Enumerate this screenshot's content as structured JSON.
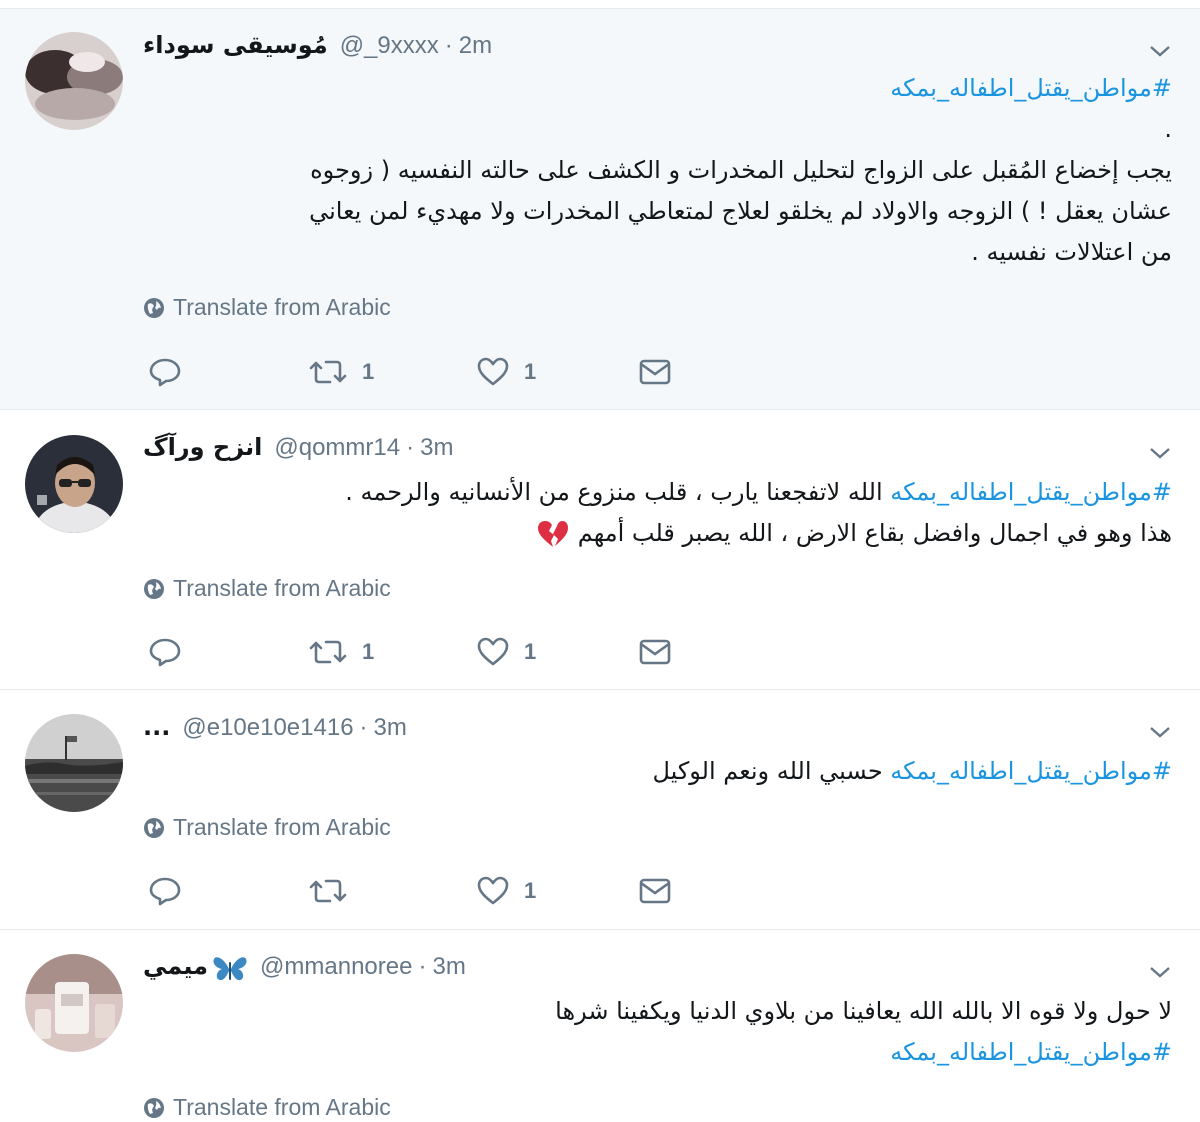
{
  "colors": {
    "hashtag": "#1b95e0",
    "muted": "#657786",
    "text": "#14171a",
    "highlight_bg": "#f5f8fa"
  },
  "tweets": [
    {
      "name": "مُوسيقى سوداء",
      "handle": "@_9xxxx",
      "sep": "·",
      "time": "2m",
      "lines": [
        {
          "tag": "#مواطن_يقتل_اطفاله_بمكه",
          "text": ""
        },
        {
          "tag": "",
          "text": "."
        },
        {
          "tag": "",
          "text": "يجب إخضاع المُقبل على الزواج لتحليل المخدرات و الكشف على حالته النفسيه ( زوجوه"
        },
        {
          "tag": "",
          "text": "عشان يعقل ! ) الزوجه والاولاد لم يخلقو لعلاج لمتعاطي المخدرات ولا مهديء لمن يعاني"
        },
        {
          "tag": "",
          "text": "من اعتلالات نفسيه ."
        }
      ],
      "translate": "Translate from Arabic",
      "retweets": "1",
      "likes": "1",
      "avatar_icon": "avatar-photo"
    },
    {
      "name": "انزح ورآگ",
      "handle": "@qommr14",
      "sep": "·",
      "time": "3m",
      "lines": [
        {
          "tag": "#مواطن_يقتل_اطفاله_بمكه",
          "text": " الله لاتفجعنا يارب ، قلب منزوع من الأنسانيه والرحمه ."
        },
        {
          "tag": "",
          "text": "هذا وهو في اجمال وافضل بقاع الارض ، الله يصبر قلب أمهم"
        }
      ],
      "emoji": "broken-heart-icon",
      "translate": "Translate from Arabic",
      "retweets": "1",
      "likes": "1",
      "avatar_icon": "avatar-photo"
    },
    {
      "name": "...",
      "handle": "@e10e10e1416",
      "sep": "·",
      "time": "3m",
      "lines": [
        {
          "tag": "#مواطن_يقتل_اطفاله_بمكه",
          "text": " حسبي الله ونعم الوكيل"
        }
      ],
      "translate": "Translate from Arabic",
      "retweets": "",
      "likes": "1",
      "avatar_icon": "avatar-photo"
    },
    {
      "name": "ميمي",
      "name_emoji": "butterfly-icon",
      "handle": "@mmannoree",
      "sep": "·",
      "time": "3m",
      "lines": [
        {
          "tag": "",
          "text": "لا حول ولا قوه الا بالله الله يعافينا من بلاوي الدنيا ويكفينا شرها"
        },
        {
          "tag": "#مواطن_يقتل_اطفاله_بمكه",
          "text": ""
        }
      ],
      "translate": "Translate from Arabic",
      "avatar_icon": "avatar-photo"
    }
  ]
}
